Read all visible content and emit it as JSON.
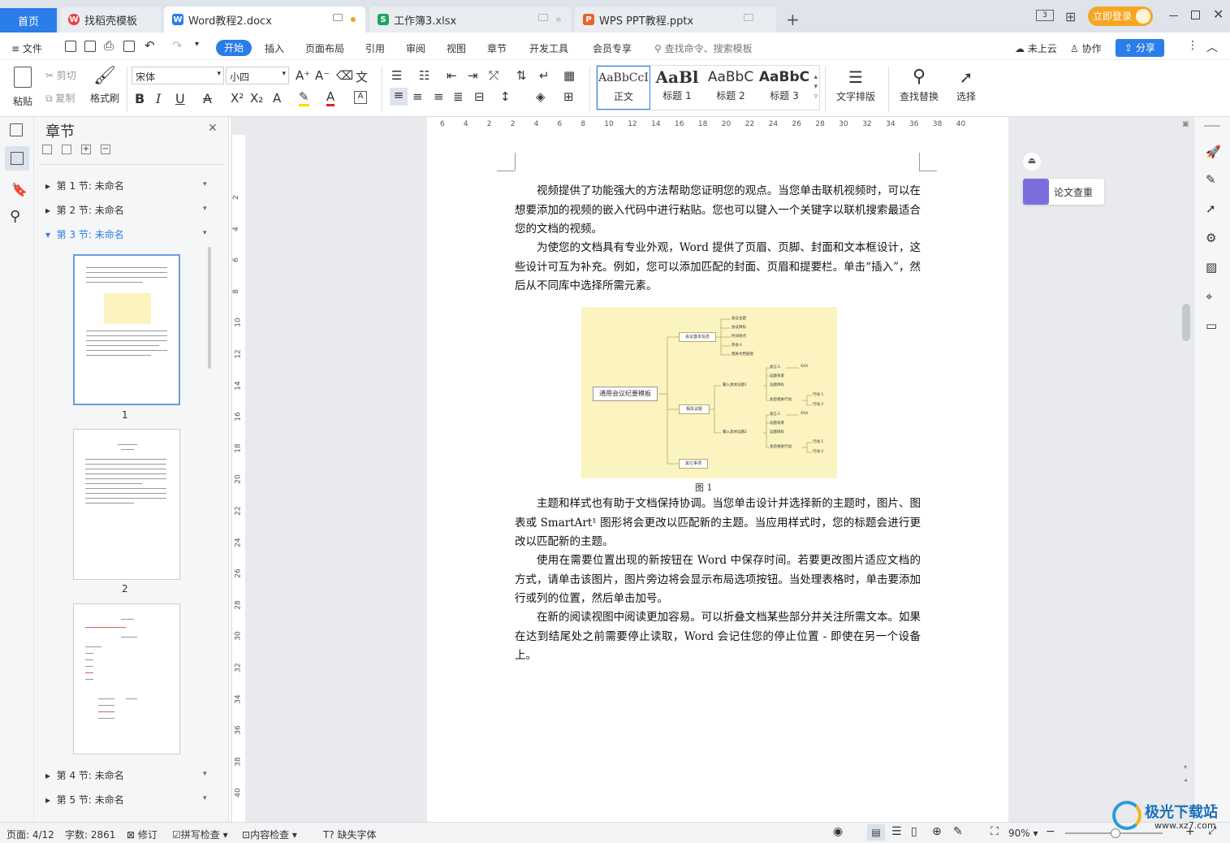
{
  "tabs": [
    {
      "label": "首页",
      "active": false
    },
    {
      "label": "找稻壳模板"
    },
    {
      "label": "Word教程2.docx",
      "active": true
    },
    {
      "label": "工作簿3.xlsx"
    },
    {
      "label": "WPS PPT教程.pptx"
    }
  ],
  "titlebar": {
    "login": "立即登录"
  },
  "menu": {
    "file": "文件",
    "items": [
      "开始",
      "插入",
      "页面布局",
      "引用",
      "审阅",
      "视图",
      "章节",
      "开发工具",
      "会员专享"
    ],
    "search_placeholder": "查找命令、搜索模板",
    "cloud": "未上云",
    "collab": "协作",
    "share": "分享"
  },
  "ribbon": {
    "paste": "粘贴",
    "cut": "剪切",
    "copy": "复制",
    "format_painter": "格式刷",
    "font_name": "宋体",
    "font_size": "小四",
    "styles": [
      {
        "preview": "AaBbCcI",
        "name": "正文"
      },
      {
        "preview": "AaBl",
        "name": "标题 1"
      },
      {
        "preview": "AaBbC",
        "name": "标题 2"
      },
      {
        "preview": "AaBbC",
        "name": "标题 3"
      }
    ],
    "text_layout": "文字排版",
    "find_replace": "查找替换",
    "select": "选择"
  },
  "nav": {
    "title": "章节",
    "sections": [
      "第 1 节: 未命名",
      "第 2 节: 未命名",
      "第 3 节: 未命名",
      "第 4 节: 未命名",
      "第 5 节: 未命名"
    ],
    "page_labels": [
      "1",
      "2"
    ]
  },
  "ruler": {
    "h_ticks": [
      "6",
      "4",
      "2",
      "2",
      "4",
      "6",
      "8",
      "10",
      "12",
      "14",
      "16",
      "18",
      "20",
      "22",
      "24",
      "26",
      "28",
      "30",
      "32",
      "34",
      "36",
      "38",
      "40"
    ],
    "v_ticks": [
      "2",
      "4",
      "6",
      "8",
      "10",
      "12",
      "14",
      "16",
      "18",
      "20",
      "22",
      "24",
      "26",
      "28",
      "30",
      "32",
      "34",
      "36",
      "38",
      "40"
    ]
  },
  "document": {
    "p1": "视频提供了功能强大的方法帮助您证明您的观点。当您单击联机视频时，可以在想要添加的视频的嵌入代码中进行粘贴。您也可以键入一个关键字以联机搜索最适合您的文档的视频。",
    "p2": "为使您的文档具有专业外观，Word 提供了页眉、页脚、封面和文本框设计，这些设计可互为补充。例如，您可以添加匹配的封面、页眉和提要栏。单击“插入”，然后从不同库中选择所需元素。",
    "figure_caption": "图 1",
    "p3": "主题和样式也有助于文档保持协调。当您单击设计并选择新的主题时，图片、图表或 SmartArt¹ 图形将会更改以匹配新的主题。当应用样式时，您的标题会进行更改以匹配新的主题。",
    "p4": "使用在需要位置出现的新按钮在 Word 中保存时间。若要更改图片适应文档的方式，请单击该图片，图片旁边将会显示布局选项按钮。当处理表格时，单击要添加行或列的位置，然后单击加号。",
    "p5": "在新的阅读视图中阅读更加容易。可以折叠文档某些部分并关注所需文本。如果在达到结尾处之前需要停止读取，Word 会记住您的停止位置 - 即使在另一个设备上。"
  },
  "mindmap": {
    "root": "通用会议纪要模板",
    "b1": "会议基本信息",
    "b1_items": [
      "会议主题",
      "会议目标",
      "时间地点",
      "参会人",
      "相关文档链接"
    ],
    "b2": "相关议题",
    "b2a": "输入具体议题1",
    "b2b": "输入具体议题2",
    "topic_items": [
      "发言人",
      "议题背景",
      "议题目标",
      "会后相关行动"
    ],
    "xxx": "XXX",
    "actions": [
      "行动 1",
      "行动 2"
    ],
    "b3": "其它事项"
  },
  "side_panel": {
    "paper_check": "论文查重"
  },
  "status": {
    "page": "页面: 4/12",
    "words": "字数: 2861",
    "revise": "修订",
    "spell": "拼写检查",
    "content": "内容检查",
    "missing_font": "缺失字体",
    "zoom": "90%"
  },
  "watermark": {
    "name": "极光下载站",
    "url": "www.xz7.com"
  },
  "colors": {
    "accent": "#2b7de9",
    "login": "#f5a623",
    "figure_bg": "#fbf3c0"
  }
}
